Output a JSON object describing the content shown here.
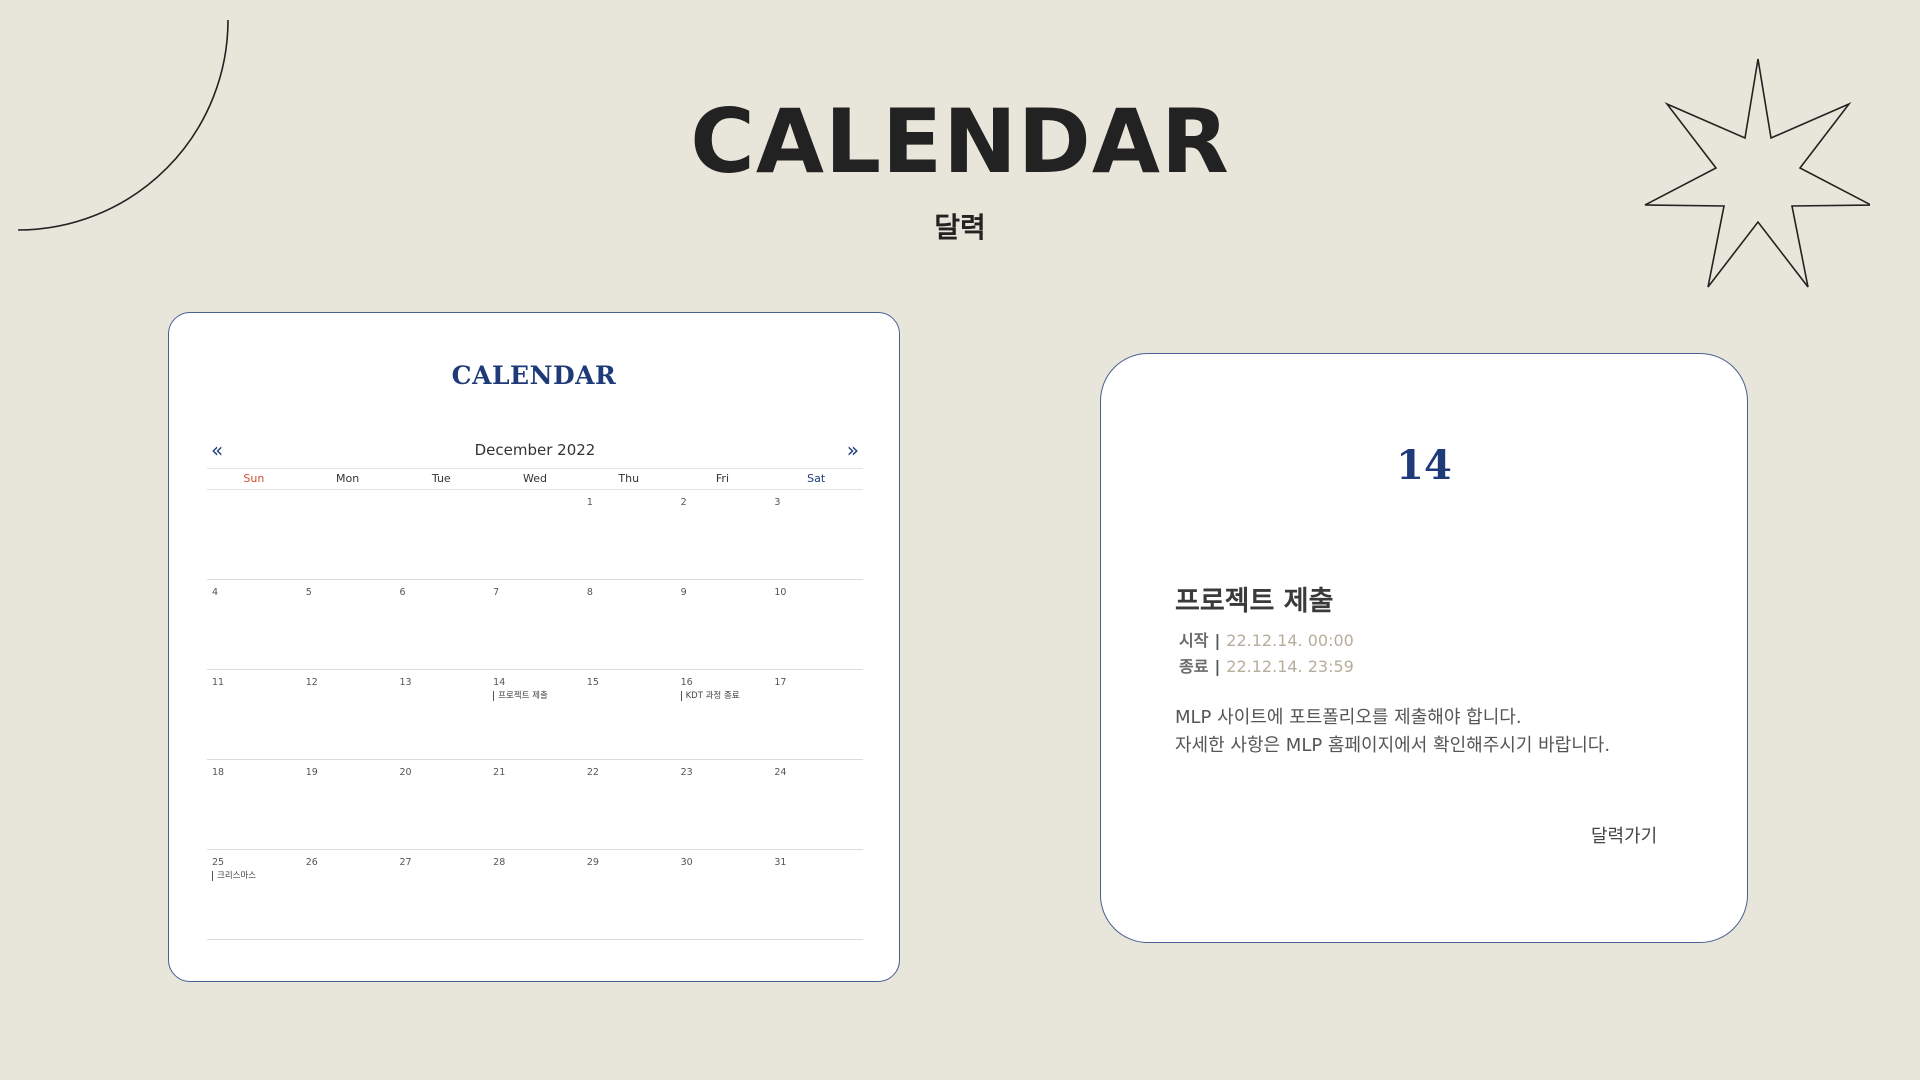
{
  "header": {
    "title": "CALENDAR",
    "subtitle": "달력"
  },
  "calendar_card": {
    "logo": "CALENDAR",
    "prev_icon": "«",
    "next_icon": "»",
    "month_label": "December 2022",
    "weekdays": [
      "Sun",
      "Mon",
      "Tue",
      "Wed",
      "Thu",
      "Fri",
      "Sat"
    ],
    "weeks": [
      [
        {
          "d": ""
        },
        {
          "d": ""
        },
        {
          "d": ""
        },
        {
          "d": ""
        },
        {
          "d": "1"
        },
        {
          "d": "2"
        },
        {
          "d": "3"
        }
      ],
      [
        {
          "d": "4"
        },
        {
          "d": "5"
        },
        {
          "d": "6"
        },
        {
          "d": "7"
        },
        {
          "d": "8"
        },
        {
          "d": "9"
        },
        {
          "d": "10"
        }
      ],
      [
        {
          "d": "11"
        },
        {
          "d": "12"
        },
        {
          "d": "13"
        },
        {
          "d": "14",
          "event": "프로젝트 제출"
        },
        {
          "d": "15"
        },
        {
          "d": "16",
          "event": "KDT 과정 종료"
        },
        {
          "d": "17"
        }
      ],
      [
        {
          "d": "18"
        },
        {
          "d": "19"
        },
        {
          "d": "20"
        },
        {
          "d": "21"
        },
        {
          "d": "22"
        },
        {
          "d": "23"
        },
        {
          "d": "24"
        }
      ],
      [
        {
          "d": "25",
          "event": "크리스마스"
        },
        {
          "d": "26"
        },
        {
          "d": "27"
        },
        {
          "d": "28"
        },
        {
          "d": "29"
        },
        {
          "d": "30"
        },
        {
          "d": "31"
        }
      ]
    ]
  },
  "event_card": {
    "date": "14",
    "title": "프로젝트 제출",
    "start_label": "시작",
    "start_value": "22.12.14. 00:00",
    "end_label": "종료",
    "end_value": "22.12.14. 23:59",
    "separator": "|",
    "desc_line1": "MLP 사이트에 포트폴리오를 제출해야 합니다.",
    "desc_line2": "자세한 사항은 MLP 홈페이지에서 확인해주시기 바랍니다.",
    "link_label": "달력가기"
  },
  "colors": {
    "background": "#e8e6da",
    "accent_navy": "#1e3a78",
    "sunday_red": "#d2502e",
    "meta_value": "#b7ad9c"
  },
  "icons": [
    "arc-decoration-icon",
    "star-decoration-icon",
    "double-chevron-left-icon",
    "double-chevron-right-icon"
  ]
}
